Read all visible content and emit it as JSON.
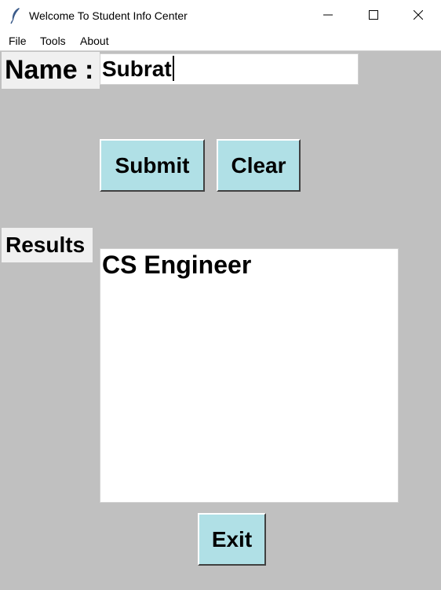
{
  "window": {
    "title": "Welcome To Student Info Center",
    "app_icon": "feather-icon",
    "controls": [
      "minimize-icon",
      "maximize-icon",
      "close-icon"
    ]
  },
  "menu": {
    "items": [
      {
        "label": "File"
      },
      {
        "label": "Tools"
      },
      {
        "label": "About"
      }
    ]
  },
  "form": {
    "name_label": "Name :",
    "name_value": "Subrat"
  },
  "buttons": {
    "submit": "Submit",
    "clear": "Clear",
    "exit": "Exit"
  },
  "results": {
    "label": "Results",
    "text": "CS Engineer"
  },
  "colors": {
    "background": "#c0c0c0",
    "button": "#b0e0e6",
    "label_bg": "#f0f0f0"
  }
}
